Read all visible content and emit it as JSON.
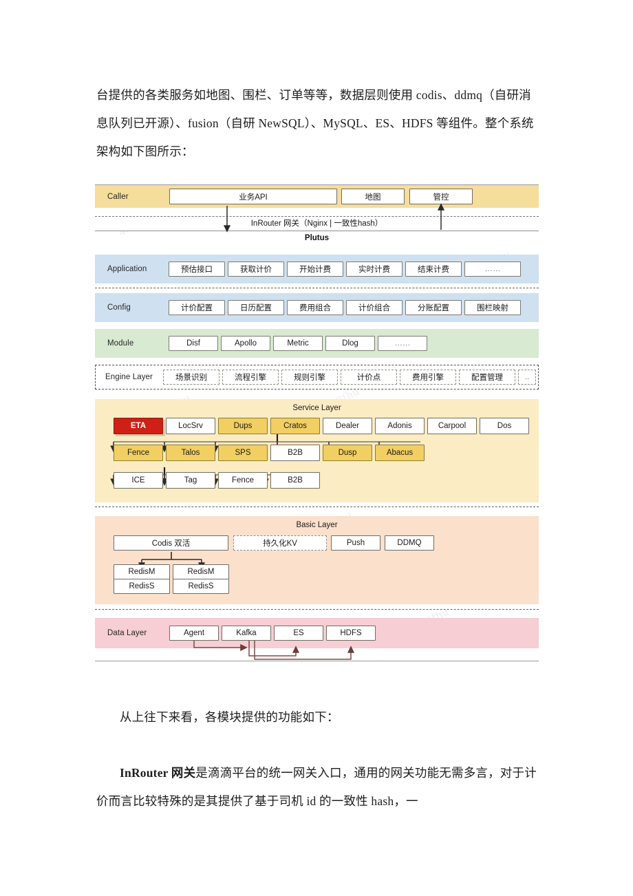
{
  "document": {
    "paragraph_top": "台提供的各类服务如地图、围栏、订单等等，数据层则使用 codis、ddmq（自研消息队列已开源）、fusion（自研 NewSQL）、MySQL、ES、HDFS 等组件。整个系统架构如下图所示：",
    "paragraph_mid": "从上往下来看，各模块提供的功能如下：",
    "paragraph_bottom_bold": "InRouter 网关",
    "paragraph_bottom_rest": "是滴滴平台的统一网关入口，通用的网关功能无需多言，对于计价而言比较特殊的是其提供了基于司机 id 的一致性 hash，一"
  },
  "figure": {
    "caller": {
      "label": "Caller",
      "nodes": [
        "业务API",
        "地图",
        "管控"
      ],
      "band_color": "#f5dd9c"
    },
    "gateway": {
      "text": "InRouter 网关（Nginx | 一致性hash）",
      "system_name": "Plutus"
    },
    "application": {
      "label": "Application",
      "nodes": [
        "预估接口",
        "获取计价",
        "开始计费",
        "实时计费",
        "结束计费",
        "……"
      ],
      "band_color": "#cfe0f0"
    },
    "config": {
      "label": "Config",
      "nodes": [
        "计价配置",
        "日历配置",
        "费用组合",
        "计价组合",
        "分账配置",
        "围栏映射"
      ],
      "band_color": "#cfe0f0"
    },
    "module": {
      "label": "Module",
      "nodes": [
        "Disf",
        "Apollo",
        "Metric",
        "Dlog",
        "……"
      ],
      "band_color": "#d8ead1"
    },
    "engine": {
      "label": "Engine Layer",
      "nodes": [
        "场景识别",
        "流程引擎",
        "规则引擎",
        "计价点",
        "费用引擎",
        "配置管理",
        ".."
      ]
    },
    "service": {
      "title": "Service Layer",
      "band_color": "#fcecc4",
      "row1": [
        "ETA",
        "LocSrv",
        "Dups",
        "Cratos",
        "Dealer",
        "Adonis",
        "Carpool",
        "Dos"
      ],
      "row2": [
        "Fence",
        "Talos",
        "SPS",
        "B2B",
        "Dusp",
        "Abacus"
      ],
      "row3": [
        "ICE",
        "Tag",
        "Fence",
        "B2B"
      ],
      "highlight_red": "ETA",
      "highlight_yellow": [
        "Dups",
        "Cratos",
        "Fence",
        "Talos",
        "SPS",
        "Dusp",
        "Abacus"
      ],
      "red_color": "#cf2016",
      "yellow_color": "#f2cf63"
    },
    "basic": {
      "title": "Basic Layer",
      "band_color": "#fbe0cb",
      "row1": [
        "Codis 双活",
        "持久化KV",
        "Push",
        "DDMQ"
      ],
      "dashed_node": "持久化KV",
      "redis_left": [
        "RedisM",
        "RedisS"
      ],
      "redis_right": [
        "RedisM",
        "RedisS"
      ]
    },
    "data": {
      "label": "Data Layer",
      "nodes": [
        "Agent",
        "Kafka",
        "ES",
        "HDFS"
      ],
      "band_color": "#f6ced3"
    }
  },
  "watermark": {
    "text": "4h4ohj8fhu"
  }
}
